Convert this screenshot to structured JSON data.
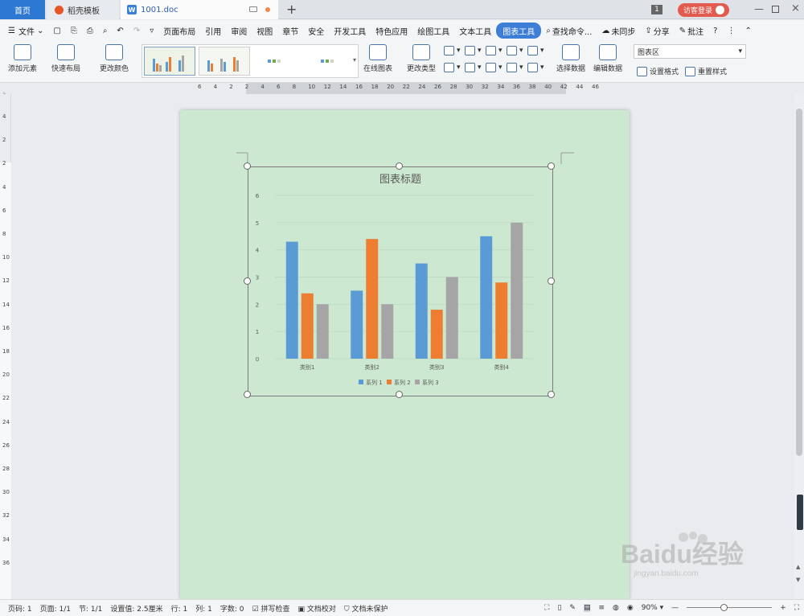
{
  "tabs": {
    "home": "首页",
    "docer": "稻壳模板",
    "doc": "1001.doc"
  },
  "titlebar": {
    "badge": "1",
    "login": "访客登录"
  },
  "menu": {
    "file": "文件",
    "items": [
      "页面布局",
      "引用",
      "审阅",
      "视图",
      "章节",
      "安全",
      "开发工具",
      "特色应用",
      "绘图工具",
      "文本工具"
    ],
    "active": "图表工具",
    "search": "查找命令...",
    "sync": "未同步",
    "share": "分享",
    "comment": "批注"
  },
  "ribbon": {
    "add_element": "添加元素",
    "quick_layout": "快速布局",
    "change_color": "更改颜色",
    "online_chart": "在线图表",
    "change_type": "更改类型",
    "select_data": "选择数据",
    "edit_data": "编辑数据",
    "chart_area": "图表区",
    "set_format": "设置格式",
    "reset_style": "重置样式"
  },
  "ruler": {
    "h": [
      "6",
      "4",
      "2",
      "2",
      "4",
      "6",
      "8",
      "10",
      "12",
      "14",
      "16",
      "18",
      "20",
      "22",
      "24",
      "26",
      "28",
      "30",
      "32",
      "34",
      "36",
      "38",
      "40",
      "42",
      "44",
      "46"
    ],
    "v": [
      "4",
      "2",
      "2",
      "4",
      "6",
      "8",
      "10",
      "12",
      "14",
      "16",
      "18",
      "20",
      "22",
      "24",
      "26",
      "28",
      "30",
      "32",
      "34",
      "36"
    ]
  },
  "chart_data": {
    "type": "bar",
    "title": "图表标题",
    "categories": [
      "类别1",
      "类别2",
      "类别3",
      "类别4"
    ],
    "series": [
      {
        "name": "系列 1",
        "values": [
          4.3,
          2.5,
          3.5,
          4.5
        ],
        "color": "#5b9bd5"
      },
      {
        "name": "系列 2",
        "values": [
          2.4,
          4.4,
          1.8,
          2.8
        ],
        "color": "#ed7d31"
      },
      {
        "name": "系列 3",
        "values": [
          2.0,
          2.0,
          3.0,
          5.0
        ],
        "color": "#a5a5a5"
      }
    ],
    "yticks": [
      "0",
      "1",
      "2",
      "3",
      "4",
      "5",
      "6"
    ],
    "ylim": [
      0,
      6
    ],
    "legend": "bottom"
  },
  "status": {
    "page": "页码: 1",
    "pages": "页面: 1/1",
    "section": "节: 1/1",
    "setting": "设置值: 2.5厘米",
    "row": "行: 1",
    "col": "列: 1",
    "words": "字数: 0",
    "spell": "拼写检查",
    "proof": "文档校对",
    "protect": "文档未保护",
    "zoom": "90%"
  },
  "watermark": {
    "text": "Baidu经验",
    "sub": "jingyan.baidu.com"
  }
}
